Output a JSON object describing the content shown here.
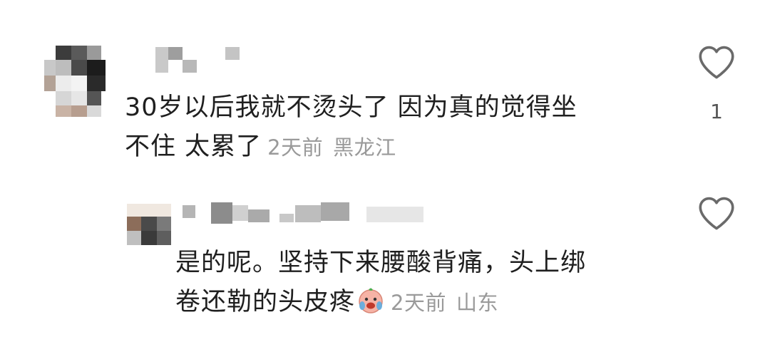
{
  "comments": [
    {
      "text_line1": "30岁以后我就不烫头了 因为真的觉得坐",
      "text_line2": "不住 太累了",
      "time": "2天前",
      "location": "黑龙江",
      "like_count": "1",
      "like_icon": "heart-outline-icon"
    },
    {
      "text_line1": "是的呢。坚持下来腰酸背痛，头上绑",
      "text_line2": "卷还勒的头皮疼",
      "emoji_icon": "crying-face-emoji-icon",
      "time": "2天前",
      "location": "山东",
      "like_icon": "heart-outline-icon"
    }
  ],
  "colors": {
    "text": "#1f1f1f",
    "meta": "#9a9a9a",
    "icon": "#6a6a6a"
  }
}
